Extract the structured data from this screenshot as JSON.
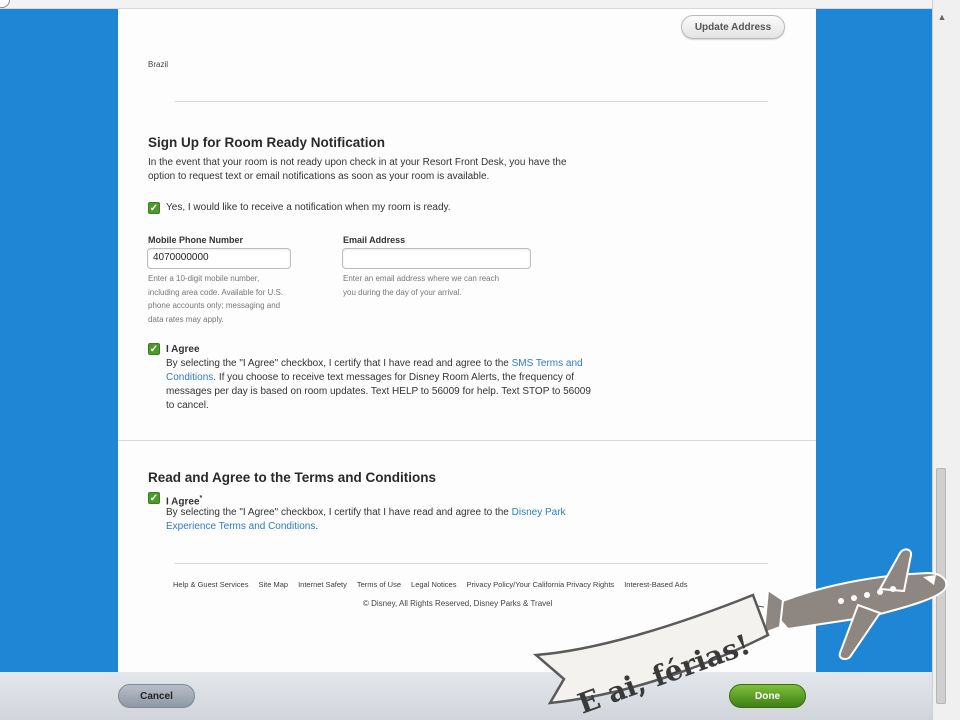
{
  "address": {
    "update_button": "Update Address",
    "country": "Brazil"
  },
  "room_ready": {
    "heading": "Sign Up for Room Ready Notification",
    "description_1": "In the event that your room is not ready upon check in at your Resort Front Desk, you have the",
    "description_2": "option to request text or email notifications as soon as your room is available.",
    "opt_in_label": "Yes, I would like to receive a notification when my room is ready.",
    "phone": {
      "label": "Mobile Phone Number",
      "value": "4070000000",
      "hint_1": "Enter a 10-digit mobile number,",
      "hint_2": "including area code. Available for U.S.",
      "hint_3": "phone accounts only; messaging and",
      "hint_4": "data rates may apply."
    },
    "email": {
      "label": "Email Address",
      "value": "",
      "hint_1": "Enter an email address where we can reach",
      "hint_2": "you during the day of your arrival."
    },
    "agree": {
      "label": "I Agree",
      "text_1a": "By selecting the \"I Agree\" checkbox, I certify that I have read and agree to the ",
      "link_1": "SMS Terms and",
      "link_2": "Conditions",
      "text_2": ". If you choose to receive text messages for Disney Room Alerts, the frequency of",
      "text_3": "messages per day is based on room updates. Text HELP to 56009 for help. Text STOP to 56009",
      "text_4": "to cancel."
    }
  },
  "terms": {
    "heading": "Read and Agree to the Terms and Conditions",
    "agree_label": "I Agree",
    "required_mark": "*",
    "text_1": "By selecting the \"I Agree\" checkbox, I certify that I have read and agree to the ",
    "link_1": "Disney Park",
    "link_2": "Experience Terms and Conditions",
    "text_end": "."
  },
  "footer": {
    "links": [
      "Help & Guest Services",
      "Site Map",
      "Internet Safety",
      "Terms of Use",
      "Legal Notices",
      "Privacy Policy/Your California Privacy Rights",
      "Interest-Based Ads"
    ],
    "copyright": "© Disney, All Rights Reserved, Disney Parks & Travel"
  },
  "actions": {
    "cancel": "Cancel",
    "done": "Done"
  },
  "stamp": {
    "banner_text": "E ai, férias!"
  },
  "colors": {
    "accent_blue": "#1f86d6",
    "link": "#2f7bbf",
    "check_green": "#4c9a2a",
    "done_green": "#5a9f27"
  }
}
